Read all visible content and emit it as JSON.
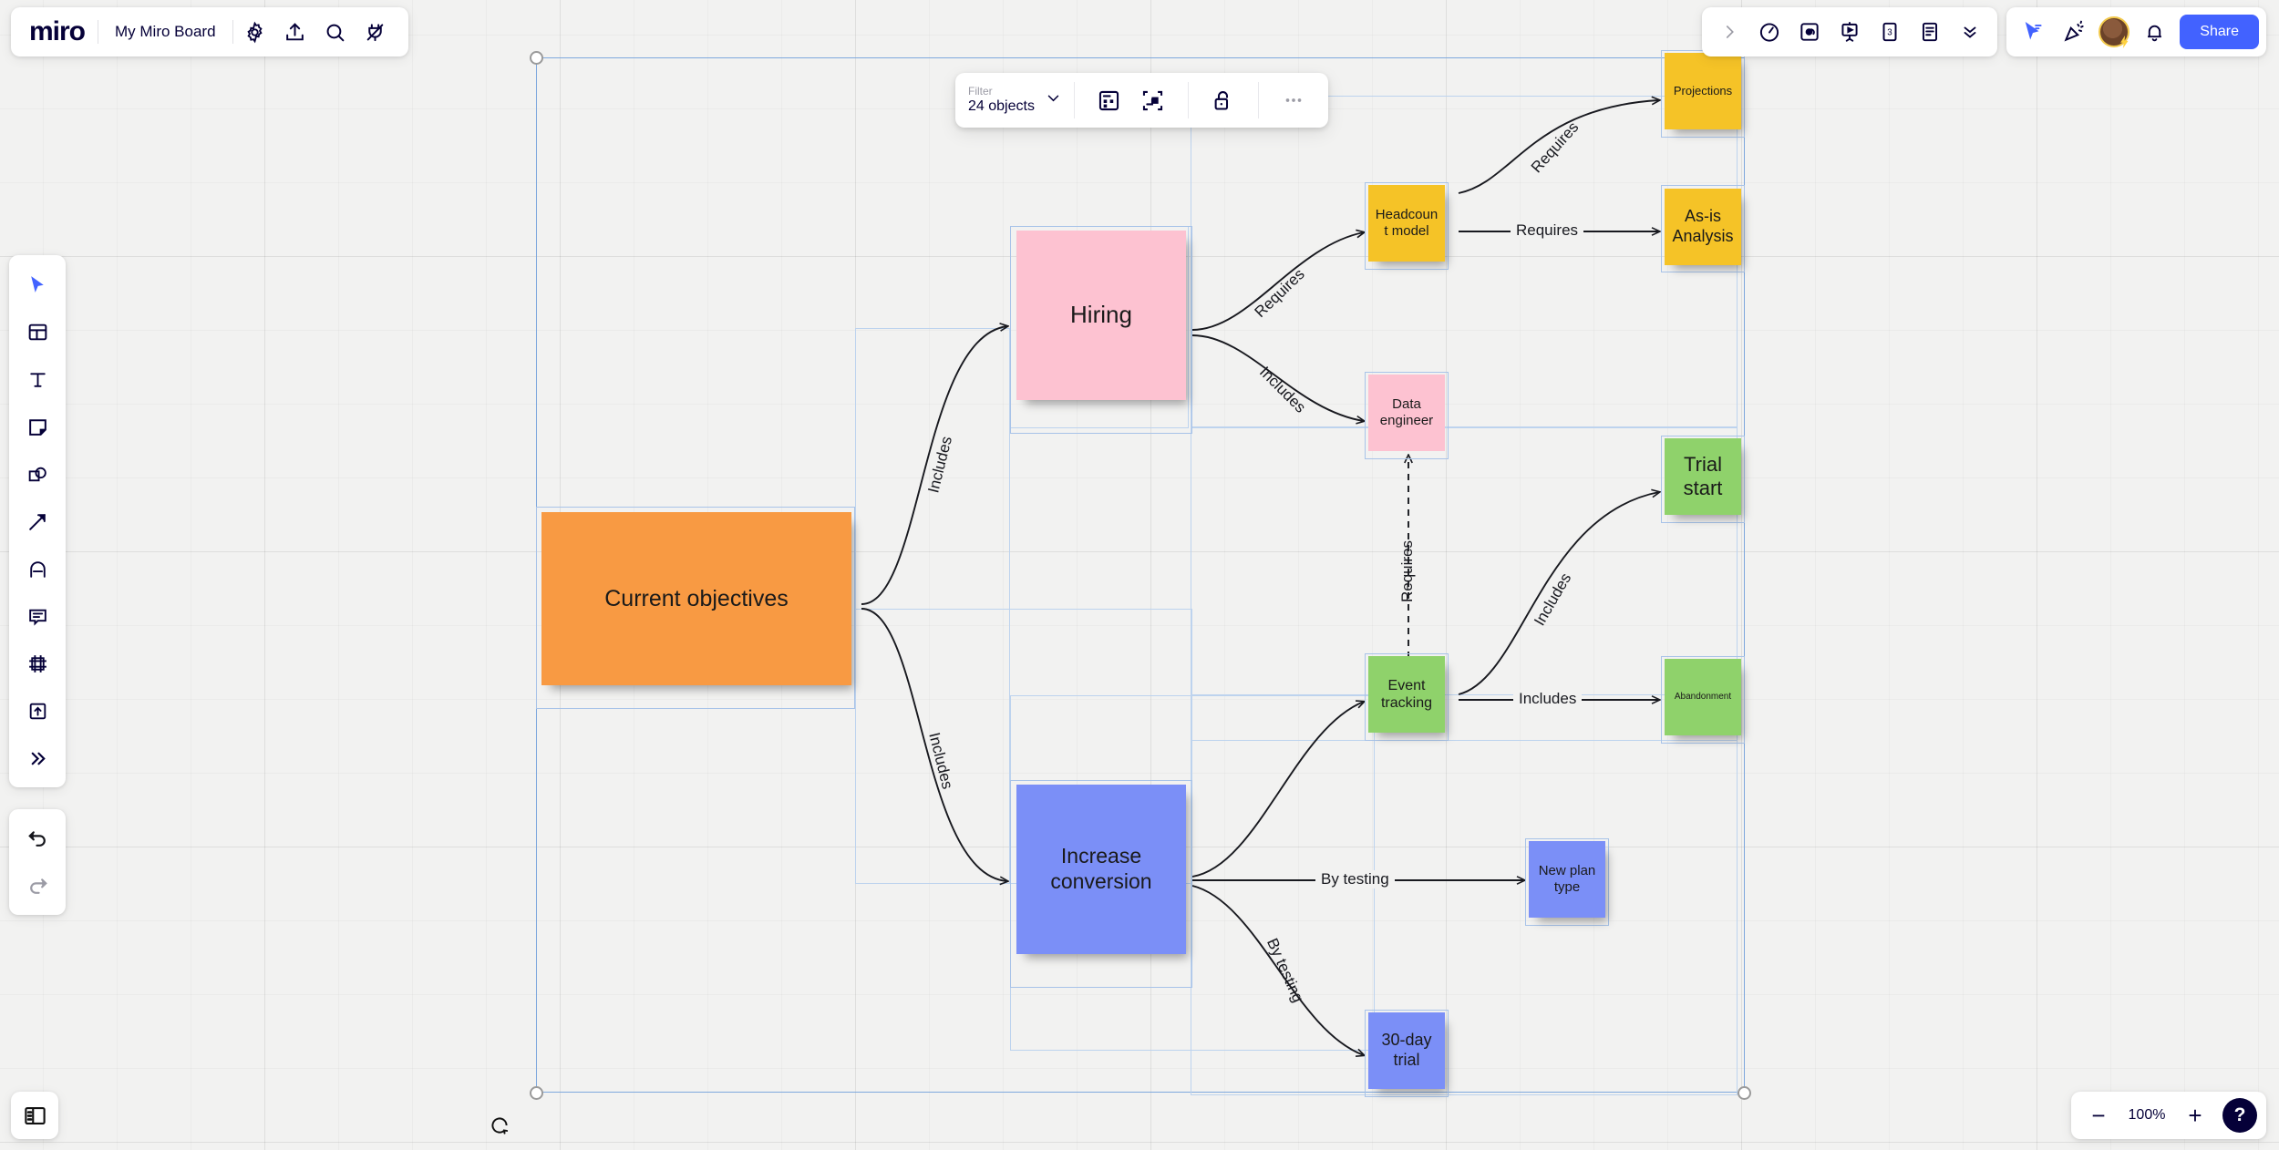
{
  "header": {
    "logo": "miro",
    "board_title": "My Miro Board",
    "left_icons": [
      {
        "name": "gear-icon",
        "label": "Settings"
      },
      {
        "name": "upload-icon",
        "label": "Upload"
      },
      {
        "name": "search-icon",
        "label": "Search"
      },
      {
        "name": "apps-plug-icon",
        "label": "Apps"
      }
    ],
    "right_icons": [
      {
        "name": "expand-chevron-icon",
        "label": "Expand"
      },
      {
        "name": "timer-icon",
        "label": "Timer"
      },
      {
        "name": "voting-icon",
        "label": "Voting"
      },
      {
        "name": "presentation-icon",
        "label": "Presentation mode"
      },
      {
        "name": "estimation-cards-icon",
        "label": "Estimation"
      },
      {
        "name": "document-icon",
        "label": "Notes"
      },
      {
        "name": "double-chevron-down-icon",
        "label": "More tools"
      }
    ],
    "collab_icons": [
      {
        "name": "cursor-share-icon",
        "label": "Bring to me"
      },
      {
        "name": "celebrate-icon",
        "label": "Reactions"
      }
    ],
    "notifications_icon": "bell-icon",
    "avatar_name": "avatar",
    "share_label": "Share"
  },
  "context_toolbar": {
    "filter_label": "Filter",
    "filter_value": "24 objects",
    "chevron_icon": "chevron-down-icon",
    "buttons": [
      {
        "name": "grid-layout-icon",
        "label": "Arrange in grid"
      },
      {
        "name": "fit-frame-icon",
        "label": "Fit to frame"
      },
      {
        "name": "unlock-icon",
        "label": "Unlock"
      },
      {
        "name": "more-options-icon",
        "label": "More"
      }
    ]
  },
  "left_toolbar": {
    "tools": [
      {
        "name": "select-cursor-tool",
        "label": "Select",
        "active": true
      },
      {
        "name": "templates-tool",
        "label": "Templates",
        "active": false
      },
      {
        "name": "text-tool",
        "label": "Text",
        "active": false
      },
      {
        "name": "sticky-note-tool",
        "label": "Sticky note",
        "active": false
      },
      {
        "name": "shapes-tool",
        "label": "Shapes",
        "active": false
      },
      {
        "name": "connector-arrow-tool",
        "label": "Connection line",
        "active": false
      },
      {
        "name": "pen-tool",
        "label": "Pen",
        "active": false
      },
      {
        "name": "comment-tool",
        "label": "Comment",
        "active": false
      },
      {
        "name": "frame-tool",
        "label": "Frame",
        "active": false
      },
      {
        "name": "upload-tool",
        "label": "Upload",
        "active": false
      },
      {
        "name": "more-tools",
        "label": "More apps",
        "active": false
      }
    ],
    "history": [
      {
        "name": "undo-button",
        "label": "Undo",
        "enabled": true
      },
      {
        "name": "redo-button",
        "label": "Redo",
        "enabled": false
      }
    ]
  },
  "footer": {
    "panel_toggle_icon": "panel-toggle-icon",
    "zoom_out_label": "−",
    "zoom_value": "100%",
    "zoom_in_label": "+",
    "help_label": "?"
  },
  "board": {
    "rotate_handle_icon": "rotate-icon",
    "notes": [
      {
        "id": "current-objectives",
        "text": "Current objectives",
        "color": "#f89a43",
        "font_size": 25
      },
      {
        "id": "hiring",
        "text": "Hiring",
        "color": "#fdc2d1",
        "font_size": 26
      },
      {
        "id": "increase-conversion",
        "text": "Increase conversion",
        "color": "#7b8ff7",
        "font_size": 23
      },
      {
        "id": "headcount-model",
        "text": "Headcount model",
        "color": "#f5c327",
        "font_size": 15
      },
      {
        "id": "data-engineer",
        "text": "Data engineer",
        "color": "#fdc2d1",
        "font_size": 15
      },
      {
        "id": "projections",
        "text": "Projections",
        "color": "#f5c327",
        "font_size": 13
      },
      {
        "id": "as-is-analysis",
        "text": "As-is Analysis",
        "color": "#f5c327",
        "font_size": 18
      },
      {
        "id": "event-tracking",
        "text": "Event tracking",
        "color": "#8fd26b",
        "font_size": 16
      },
      {
        "id": "trial-start",
        "text": "Trial start",
        "color": "#8fd26b",
        "font_size": 22
      },
      {
        "id": "abandonment",
        "text": "Abandonment",
        "color": "#8fd26b",
        "font_size": 10
      },
      {
        "id": "new-plan-type",
        "text": "New plan type",
        "color": "#7b8ff7",
        "font_size": 15
      },
      {
        "id": "thirty-day-trial",
        "text": "30-day trial",
        "color": "#7b8ff7",
        "font_size": 18
      }
    ],
    "connector_labels": [
      {
        "id": "obj-hiring",
        "text": "Includes"
      },
      {
        "id": "obj-conversion",
        "text": "Includes"
      },
      {
        "id": "hiring-headcount",
        "text": "Requires"
      },
      {
        "id": "hiring-data-eng",
        "text": "Includes"
      },
      {
        "id": "headcount-proj",
        "text": "Requires"
      },
      {
        "id": "headcount-asis",
        "text": "Requires"
      },
      {
        "id": "dataeng-event",
        "text": "Requires"
      },
      {
        "id": "event-trial",
        "text": "Includes"
      },
      {
        "id": "event-abandon",
        "text": "Includes"
      },
      {
        "id": "conv-newplan",
        "text": "By testing"
      },
      {
        "id": "conv-30day",
        "text": "By testing"
      }
    ]
  }
}
